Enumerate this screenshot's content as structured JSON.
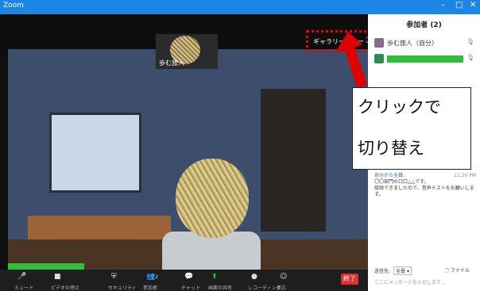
{
  "window": {
    "title": "Zoom",
    "minimize": "–",
    "maximize": "□",
    "close": "✕"
  },
  "stage": {
    "thumbnail_name": "歩む旅人",
    "gallery_view_label": "ギャラリービュー",
    "fullscreen_icon": "⛶"
  },
  "toolbar": {
    "mute": "ミュート",
    "video": "ビデオの停止",
    "security": "セキュリティ",
    "participants": "参加者",
    "participants_count": "2",
    "chat": "チャット",
    "share": "画面の共有",
    "record": "レコーディング",
    "reactions": "反応",
    "end": "終了"
  },
  "panel": {
    "header": "参加者 (2)",
    "participants": [
      {
        "name": "歩む旅人（自分）",
        "color": "#8a6a8e"
      },
      {
        "name": "",
        "color": "#2e8b57"
      }
    ],
    "chat": {
      "header": "自分から全員:",
      "time": "11:20 PM",
      "lines": [
        "〇〇部門の口口△△です。",
        "接続できましたので、音声テストをお願いします。"
      ]
    },
    "to_label": "送信先:",
    "to_value": "全員 ▾",
    "file_label": "ファイル",
    "input_placeholder": "ここにメッセージを入力します…"
  },
  "callout": {
    "line1": "クリックで",
    "line2": "切り替え"
  },
  "colors": {
    "titlebar": "#1c86e6",
    "annotation": "#e00000",
    "speaking": "#2fbf3a",
    "end": "#e0312f"
  }
}
